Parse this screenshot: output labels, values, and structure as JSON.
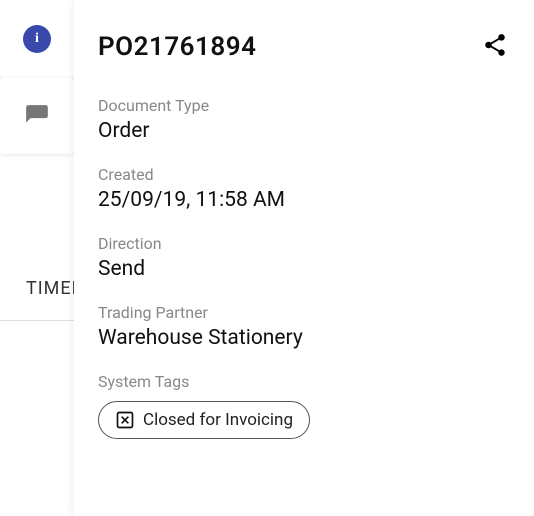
{
  "sidebar": {
    "timeline_label": "TIMELINE"
  },
  "panel": {
    "title": "PO21761894",
    "fields": {
      "doc_type": {
        "label": "Document Type",
        "value": "Order"
      },
      "created": {
        "label": "Created",
        "value": "25/09/19, 11:58 AM"
      },
      "direction": {
        "label": "Direction",
        "value": "Send"
      },
      "partner": {
        "label": "Trading Partner",
        "value": "Warehouse Stationery"
      },
      "tags": {
        "label": "System Tags",
        "value": "Closed for Invoicing"
      }
    }
  }
}
